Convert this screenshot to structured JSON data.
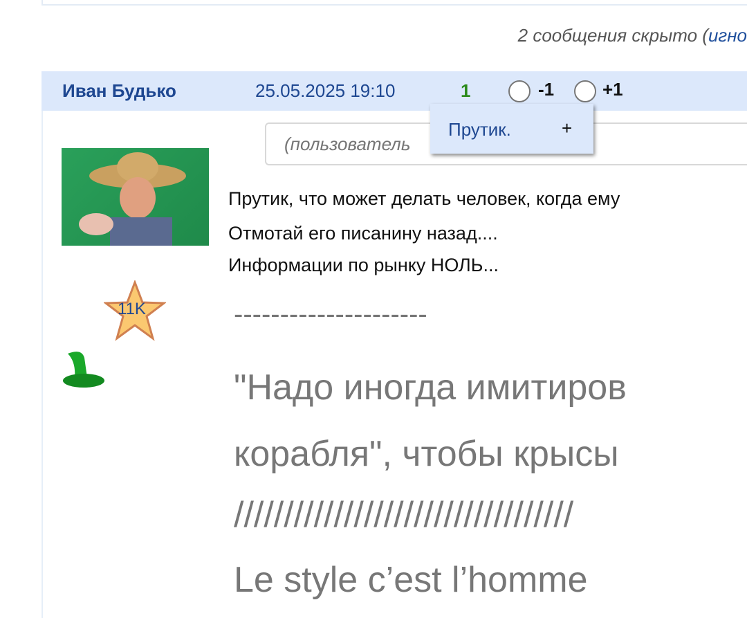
{
  "hidden_notice": {
    "text": "2 сообщения скрыто (",
    "link": "игно"
  },
  "post": {
    "author": "Иван Будько",
    "date": "25.05.2025 19:10",
    "score": "1",
    "vote_minus": "-1",
    "vote_plus": "+1",
    "search_placeholder": "(пользователь",
    "popup": {
      "name": "Прутик.",
      "plus": "+"
    },
    "badge": "11K",
    "lines": [
      "Прутик, что может делать человек, когда ему",
      "Отмотай его писанину назад....",
      "Информации по рынку НОЛЬ..."
    ],
    "signature": [
      "---------------------",
      "\"Надо иногда имитиров",
      "корабля\", чтобы крысы",
      "//////////////////////////////////",
      "Le style c’est l’homme"
    ]
  }
}
